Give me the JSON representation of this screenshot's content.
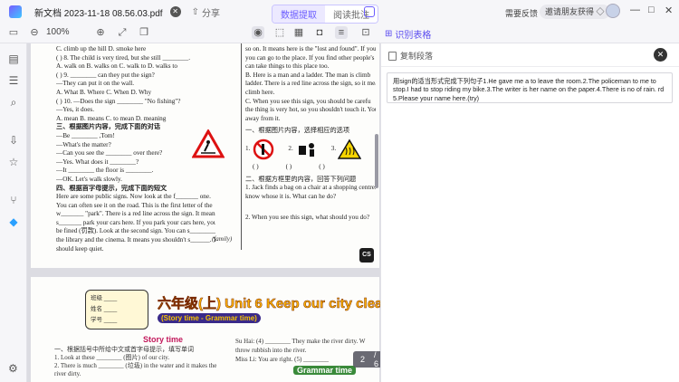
{
  "titlebar": {
    "doc_title": "新文档 2023-11-18 08.56.03.pdf",
    "share_label": "分享",
    "mode_tabs": [
      "数据提取",
      "阅读批注"
    ],
    "active_mode": 0,
    "feedback_label": "需要反馈",
    "invite_label": "邀请朋友获得",
    "window_controls": [
      "—",
      "□",
      "✕"
    ]
  },
  "toolbar": {
    "zoom_value": "100%",
    "recognize_table_label": "识别表格"
  },
  "document": {
    "page1_left": [
      "C. climb up the hill          D. smoke here",
      "(  ) 8. The child is very tired, but she still ________.",
      "   A. walk on     B. walks on     C. walk to     D. walks to",
      "(  ) 9. ________ can they put the sign?",
      "   —They can put it on the wall.",
      "   A. What     B. Where     C. When     D. Why",
      "(  ) 10. —Does the sign ________ \"No fishing\"?",
      "   —Yes, it does.",
      "   A. mean     B. means     C. to mean     D. meaning",
      "三、根据图片内容，完成下面的对话",
      "—Be ________ ,Tom!",
      "—What's the matter?",
      "—Can you see the ________ over there?",
      "—Yes. What does it ________?",
      "—It ________ the floor is ________.",
      "—OK. Let's walk slowly.",
      "四、根据首字母提示，完成下面的短文",
      "   Here are some public signs. Now look at the f_______ one.",
      "You can often see it on the road. This is the first letter of the",
      "w_______ \"park\". There is a red line across the sign. It means you",
      "s_______ park your cars here. If you park your cars here, you may",
      "be fined (罚款). Look at the second sign. You can s________ it in",
      "the library and the cinema. It means you shouldn't s______. You",
      "should keep quiet."
    ],
    "page1_family": "(family)",
    "page1_right": [
      "so on. It means here is the \"lost and found\". If you lose s",
      "you can go to the place. If you find other people's lost t",
      "can take things to this place too.",
      "   B. Here is a man and a ladder. The man is climb",
      "ladder. There is a red line across the sign, so it means y",
      "climb here.",
      "   C. When you see this sign, you should be carefu",
      "the thing is very hot, so you shouldn't touch it. You'd",
      "away from it.",
      "一、根据图片内容，选择相应的选项",
      "二、根据方框里的内容，回答下列问题",
      "1. Jack finds a bag on a chair at a shopping centre. H",
      "   know whose it is. What can he do?",
      "2. When you see this sign, what should you do?"
    ],
    "sign_numbers": [
      "1.",
      "2.",
      "3."
    ],
    "sign_parens": [
      "(   )",
      "(   )",
      "(   )"
    ],
    "cs_badge": "CS",
    "page2_banner": "六年级(上) Unit 6 Keep our city clean",
    "page2_sub": "(Story time - Grammar time)",
    "page2_label_lines": [
      "班级 ____",
      "姓名 ____",
      "学号 ____"
    ],
    "page2_story": "Story time",
    "page2_lines": [
      "一、根据括号中所给中文或首字母提示，填写单词",
      "1. Look at these ________ (图片) of our city.",
      "2. There is much ________ (垃圾) in the water and it makes the",
      "   river dirty."
    ],
    "page2_right": [
      "Su Hai: (4) ________ They make the river dirty. W",
      "        throw rubbish into the river.",
      "Miss Li: You are right. (5) ________"
    ],
    "page2_grammar": "Grammar time",
    "current_page": "2",
    "total_pages": "/ 6"
  },
  "panel": {
    "copy_label": "复制段落",
    "result_text": "用sign的适当形式完成下列句子1.He gave me a to leave the room.2.The policeman to me to stop.I had to stop riding my bike.3.The writer is her name on the paper.4.There is no of rain. rd 5.Please your name here.(try)"
  }
}
